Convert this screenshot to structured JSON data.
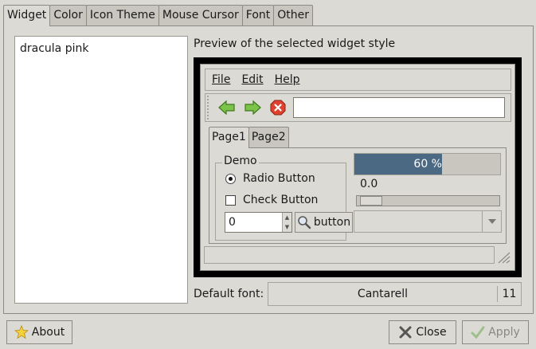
{
  "tabs": [
    {
      "label": "Widget",
      "active": true
    },
    {
      "label": "Color",
      "active": false
    },
    {
      "label": "Icon Theme",
      "active": false
    },
    {
      "label": "Mouse Cursor",
      "active": false
    },
    {
      "label": "Font",
      "active": false
    },
    {
      "label": "Other",
      "active": false
    }
  ],
  "theme_list": {
    "items": [
      "dracula pink"
    ]
  },
  "preview": {
    "label": "Preview of the selected widget style",
    "menu": {
      "file": "File",
      "edit": "Edit",
      "help": "Help"
    },
    "toolbar": {
      "back_icon": "back-arrow-icon",
      "forward_icon": "forward-arrow-icon",
      "stop_icon": "stop-icon",
      "entry_value": ""
    },
    "tabs": [
      "Page1",
      "Page2"
    ],
    "demo": {
      "legend": "Demo",
      "radio_label": "Radio Button",
      "check_label": "Check Button",
      "spin_value": "0",
      "button_label": "button"
    },
    "progress": {
      "fraction": 0.6,
      "label": "60 %"
    },
    "scale_value": "0.0"
  },
  "font": {
    "label": "Default font:",
    "name": "Cantarell",
    "size": "11"
  },
  "buttons": {
    "about": "About",
    "close": "Close",
    "apply": "Apply"
  },
  "colors": {
    "accent": "#4b6983",
    "background": "#dcdad5",
    "stop_red": "#d93a2e",
    "arrow_green": "#4fa83a"
  }
}
